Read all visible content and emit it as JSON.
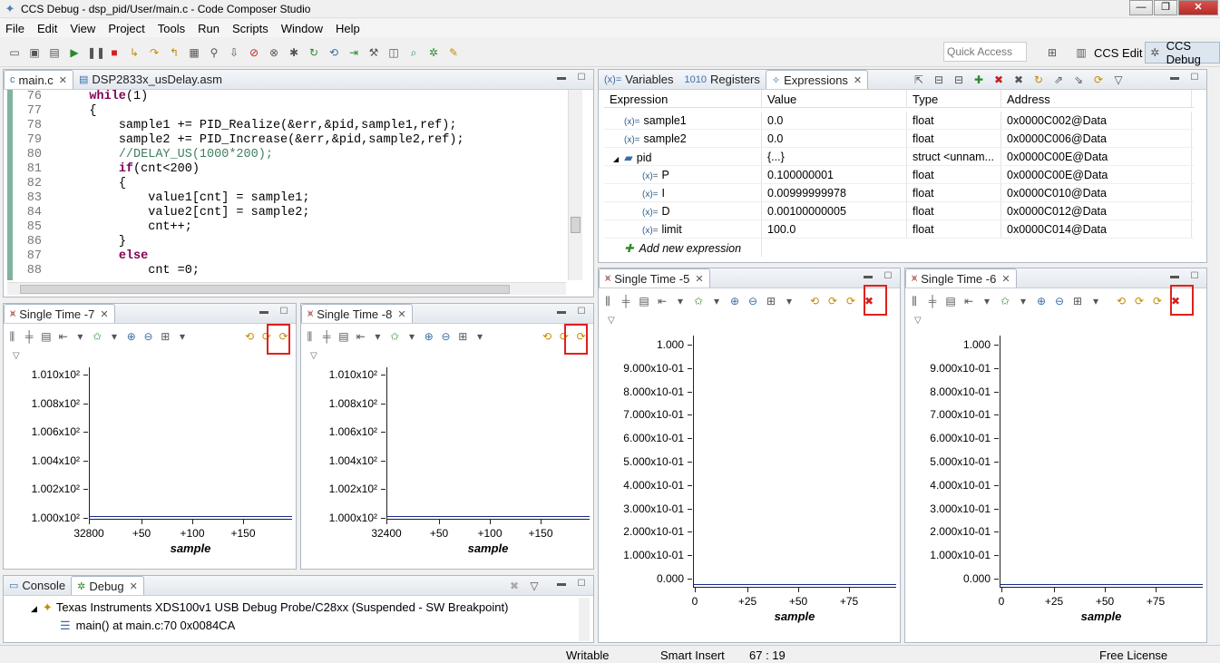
{
  "window": {
    "title": "CCS Debug - dsp_pid/User/main.c - Code Composer Studio"
  },
  "menu": [
    "File",
    "Edit",
    "View",
    "Project",
    "Tools",
    "Run",
    "Scripts",
    "Window",
    "Help"
  ],
  "toolbar": {
    "quick_access_placeholder": "Quick Access",
    "persp_edit": "CCS Edit",
    "persp_debug": "CCS Debug"
  },
  "editor": {
    "tabs": [
      "main.c",
      "DSP2833x_usDelay.asm"
    ],
    "line_numbers": [
      "76",
      "77",
      "78",
      "79",
      "80",
      "81",
      "82",
      "83",
      "84",
      "85",
      "86",
      "87",
      "88"
    ],
    "lines": [
      {
        "k": "while",
        "r": "(1)",
        "i": "    "
      },
      {
        "r": "{",
        "i": "    "
      },
      {
        "r": "sample1 += PID_Realize(&err,&pid,sample1,ref);",
        "i": "        "
      },
      {
        "r": "sample2 += PID_Increase(&err,&pid,sample2,ref);",
        "i": "        "
      },
      {
        "c": "//DELAY_US(1000*200);",
        "i": "        "
      },
      {
        "k": "if",
        "r": "(cnt<200)",
        "i": "        "
      },
      {
        "r": "{",
        "i": "        "
      },
      {
        "r": "value1[cnt] = sample1;",
        "i": "            "
      },
      {
        "r": "value2[cnt] = sample2;",
        "i": "            "
      },
      {
        "r": "cnt++;",
        "i": "            "
      },
      {
        "r": "}",
        "i": "        "
      },
      {
        "k": "else",
        "r": "",
        "i": "        "
      },
      {
        "r": "cnt =0;",
        "i": "            "
      }
    ]
  },
  "expressions_panel": {
    "tabs": [
      "Variables",
      "Registers",
      "Expressions"
    ],
    "columns": [
      "Expression",
      "Value",
      "Type",
      "Address"
    ],
    "rows": [
      {
        "name": "sample1",
        "value": "0.0",
        "type": "float",
        "address": "0x0000C002@Data",
        "indent": 1
      },
      {
        "name": "sample2",
        "value": "0.0",
        "type": "float",
        "address": "0x0000C006@Data",
        "indent": 1
      },
      {
        "name": "pid",
        "value": "{...}",
        "type": "struct <unnam...",
        "address": "0x0000C00E@Data",
        "indent": 0
      },
      {
        "name": "P",
        "value": "0.100000001",
        "type": "float",
        "address": "0x0000C00E@Data",
        "indent": 2
      },
      {
        "name": "I",
        "value": "0.00999999978",
        "type": "float",
        "address": "0x0000C010@Data",
        "indent": 2
      },
      {
        "name": "D",
        "value": "0.00100000005",
        "type": "float",
        "address": "0x0000C012@Data",
        "indent": 2
      },
      {
        "name": "limit",
        "value": "100.0",
        "type": "float",
        "address": "0x0000C014@Data",
        "indent": 2
      }
    ],
    "add_new": "Add new expression"
  },
  "graphs": {
    "g7": {
      "tab": "Single Time -7",
      "yticks": [
        "1.010x10²",
        "1.008x10²",
        "1.006x10²",
        "1.004x10²",
        "1.002x10²",
        "1.000x10²"
      ],
      "xticks": [
        "32800",
        "+50",
        "+100",
        "+150"
      ],
      "xtitle": "sample"
    },
    "g8": {
      "tab": "Single Time -8",
      "yticks": [
        "1.010x10²",
        "1.008x10²",
        "1.006x10²",
        "1.004x10²",
        "1.002x10²",
        "1.000x10²"
      ],
      "xticks": [
        "32400",
        "+50",
        "+100",
        "+150"
      ],
      "xtitle": "sample"
    },
    "g5": {
      "tab": "Single Time -5",
      "yticks": [
        "1.000",
        "9.000x10-01",
        "8.000x10-01",
        "7.000x10-01",
        "6.000x10-01",
        "5.000x10-01",
        "4.000x10-01",
        "3.000x10-01",
        "2.000x10-01",
        "1.000x10-01",
        "0.000"
      ],
      "xticks": [
        "0",
        "+25",
        "+50",
        "+75"
      ],
      "xtitle": "sample"
    },
    "g6": {
      "tab": "Single Time -6",
      "yticks": [
        "1.000",
        "9.000x10-01",
        "8.000x10-01",
        "7.000x10-01",
        "6.000x10-01",
        "5.000x10-01",
        "4.000x10-01",
        "3.000x10-01",
        "2.000x10-01",
        "1.000x10-01",
        "0.000"
      ],
      "xticks": [
        "0",
        "+25",
        "+50",
        "+75"
      ],
      "xtitle": "sample"
    }
  },
  "debug_panel": {
    "tabs": [
      "Console",
      "Debug"
    ],
    "target": "Texas Instruments XDS100v1 USB Debug Probe/C28xx (Suspended - SW Breakpoint)",
    "frame": "main() at main.c:70 0x0084CA"
  },
  "status": {
    "writable": "Writable",
    "insert": "Smart Insert",
    "position": "67 : 19",
    "license": "Free License"
  }
}
